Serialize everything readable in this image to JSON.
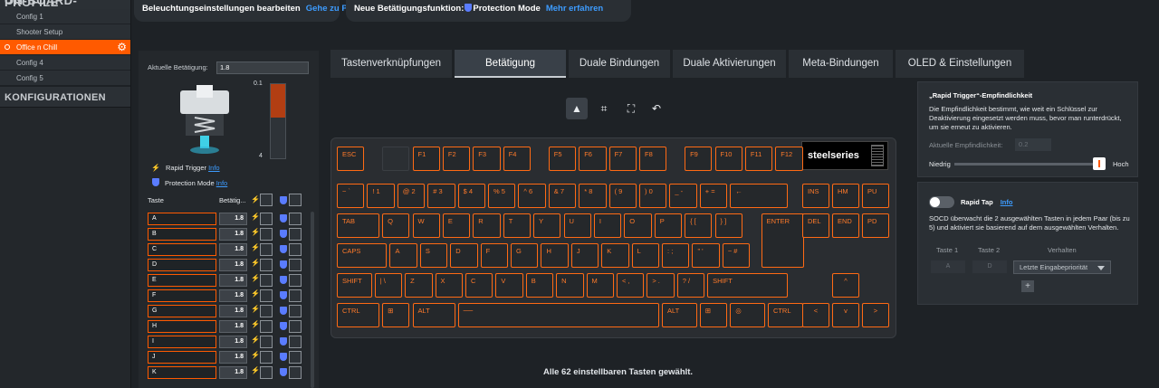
{
  "sidebar": {
    "header": "ON-BOARD-PROFILE",
    "configs": [
      {
        "label": "Config 1",
        "active": false
      },
      {
        "label": "Shooter Setup",
        "active": false
      },
      {
        "label": "Office n Chill",
        "active": true
      },
      {
        "label": "Config 4",
        "active": false
      },
      {
        "label": "Config 5",
        "active": false
      }
    ],
    "section": "KONFIGURATIONEN"
  },
  "topbar": {
    "lighting_label": "Beleuchtungseinstellungen bearbeiten",
    "lighting_link": "Gehe zu Prism",
    "new_feature_label": "Neue Betätigungsfunktion:",
    "new_feature_name": "Protection Mode",
    "new_feature_link": "Mehr erfahren"
  },
  "actuation": {
    "current_label": "Aktuelle Betätigung:",
    "current_value": "1.8",
    "gauge_top": "0.1",
    "gauge_bottom": "4",
    "gauge_level": 0.45,
    "rapid_trigger": "Rapid Trigger",
    "rapid_info": "Info",
    "protection": "Protection Mode",
    "protection_info": "Info",
    "col_key": "Taste",
    "col_act": "Betätig...",
    "keys": [
      {
        "name": "A",
        "value": "1.8"
      },
      {
        "name": "B",
        "value": "1.8"
      },
      {
        "name": "C",
        "value": "1.8"
      },
      {
        "name": "D",
        "value": "1.8"
      },
      {
        "name": "E",
        "value": "1.8"
      },
      {
        "name": "F",
        "value": "1.8"
      },
      {
        "name": "G",
        "value": "1.8"
      },
      {
        "name": "H",
        "value": "1.8"
      },
      {
        "name": "I",
        "value": "1.8"
      },
      {
        "name": "J",
        "value": "1.8"
      },
      {
        "name": "K",
        "value": "1.8"
      }
    ]
  },
  "tabs": [
    {
      "label": "Tastenverknüpfungen",
      "active": false
    },
    {
      "label": "Betätigung",
      "active": true
    },
    {
      "label": "Duale Bindungen",
      "active": false
    },
    {
      "label": "Duale Aktivierungen",
      "active": false
    },
    {
      "label": "Meta-Bindungen",
      "active": false
    },
    {
      "label": "OLED & Einstellungen",
      "active": false
    }
  ],
  "toolbar": {
    "select_icon": "▲",
    "box_icon": "⌗",
    "expand_icon": "⛶",
    "undo_icon": "↶"
  },
  "keyboard": {
    "brand": "steelseries",
    "rows": [
      [
        [
          "ESC",
          1,
          1
        ],
        [
          null,
          0.5
        ],
        [
          "",
          1,
          0
        ],
        [
          "F1",
          1,
          1
        ],
        [
          "F2",
          1,
          1
        ],
        [
          "F3",
          1,
          1
        ],
        [
          "F4",
          1,
          1
        ],
        [
          null,
          0.5
        ],
        [
          "F5",
          1,
          1
        ],
        [
          "F6",
          1,
          1
        ],
        [
          "F7",
          1,
          1
        ],
        [
          "F8",
          1,
          1
        ],
        [
          null,
          0.5
        ],
        [
          "F9",
          1,
          1
        ],
        [
          "F10",
          1,
          1
        ],
        [
          "F11",
          1,
          1
        ],
        [
          "F12",
          1,
          1
        ]
      ],
      [
        [
          "~ `",
          1,
          1
        ],
        [
          "! 1",
          1,
          1
        ],
        [
          "@ 2",
          1,
          1
        ],
        [
          "# 3",
          1,
          1
        ],
        [
          "$ 4",
          1,
          1
        ],
        [
          "% 5",
          1,
          1
        ],
        [
          "^ 6",
          1,
          1
        ],
        [
          "& 7",
          1,
          1
        ],
        [
          "* 8",
          1,
          1
        ],
        [
          "( 9",
          1,
          1
        ],
        [
          ") 0",
          1,
          1
        ],
        [
          "_ -",
          1,
          1
        ],
        [
          "+ =",
          1,
          1
        ],
        [
          "←",
          2,
          1
        ]
      ],
      [
        [
          "TAB",
          1.5,
          1
        ],
        [
          "Q",
          1,
          1
        ],
        [
          "W",
          1,
          1
        ],
        [
          "E",
          1,
          1
        ],
        [
          "R",
          1,
          1
        ],
        [
          "T",
          1,
          1
        ],
        [
          "Y",
          1,
          1
        ],
        [
          "U",
          1,
          1
        ],
        [
          "I",
          1,
          1
        ],
        [
          "O",
          1,
          1
        ],
        [
          "P",
          1,
          1
        ],
        [
          "{ [",
          1,
          1
        ],
        [
          "} ]",
          1,
          1
        ]
      ],
      [
        [
          "CAPS",
          1.75,
          1
        ],
        [
          "A",
          1,
          1
        ],
        [
          "S",
          1,
          1
        ],
        [
          "D",
          1,
          1
        ],
        [
          "F",
          1,
          1
        ],
        [
          "G",
          1,
          1
        ],
        [
          "H",
          1,
          1
        ],
        [
          "J",
          1,
          1
        ],
        [
          "K",
          1,
          1
        ],
        [
          "L",
          1,
          1
        ],
        [
          ": ;",
          1,
          1
        ],
        [
          "\" '",
          1,
          1
        ],
        [
          "~ #",
          1,
          1
        ]
      ],
      [
        [
          "SHIFT",
          1.25,
          1
        ],
        [
          "| \\",
          1,
          1
        ],
        [
          "Z",
          1,
          1
        ],
        [
          "X",
          1,
          1
        ],
        [
          "C",
          1,
          1
        ],
        [
          "V",
          1,
          1
        ],
        [
          "B",
          1,
          1
        ],
        [
          "N",
          1,
          1
        ],
        [
          "M",
          1,
          1
        ],
        [
          "< ,",
          1,
          1
        ],
        [
          "> .",
          1,
          1
        ],
        [
          "? /",
          1,
          1
        ],
        [
          "SHIFT",
          2.75,
          1
        ]
      ],
      [
        [
          "CTRL",
          1.5,
          1
        ],
        [
          "⊞",
          1,
          1
        ],
        [
          "ALT",
          1.5,
          1
        ],
        [
          "──",
          6.75,
          1
        ],
        [
          "ALT",
          1.25,
          1
        ],
        [
          "⊞",
          1,
          1
        ],
        [
          "◎",
          1.25,
          1
        ],
        [
          "CTRL",
          1.25,
          1
        ]
      ]
    ],
    "enter_label": "ENTER",
    "nav": [
      [
        "INS",
        "HM",
        "PU"
      ],
      [
        "DEL",
        "END",
        "PD"
      ]
    ],
    "up": "^",
    "arrows": [
      "<",
      "v",
      ">"
    ],
    "status": "Alle 62 einstellbaren Tasten gewählt."
  },
  "rapid_panel": {
    "title": "„Rapid Trigger“-Empfindlichkeit",
    "desc": "Die Empfindlichkeit bestimmt, wie weit ein Schlüssel zur Deaktivierung eingesetzt werden muss, bevor man runterdrückt, um sie erneut zu aktivieren.",
    "current_label": "Aktuelle Empfindlichkeit:",
    "current_value": "0.2",
    "low": "Niedrig",
    "high": "Hoch"
  },
  "rapid_tap": {
    "title": "Rapid Tap",
    "info": "Info",
    "desc": "SOCD überwacht die 2 ausgewählten Tasten in jedem Paar (bis zu 5) und aktiviert sie basierend auf dem ausgewählten Verhalten.",
    "col1": "Taste 1",
    "col2": "Taste 2",
    "col3": "Verhalten",
    "key1": "A",
    "key2": "D",
    "behavior": "Letzte Eingabepriorität"
  }
}
